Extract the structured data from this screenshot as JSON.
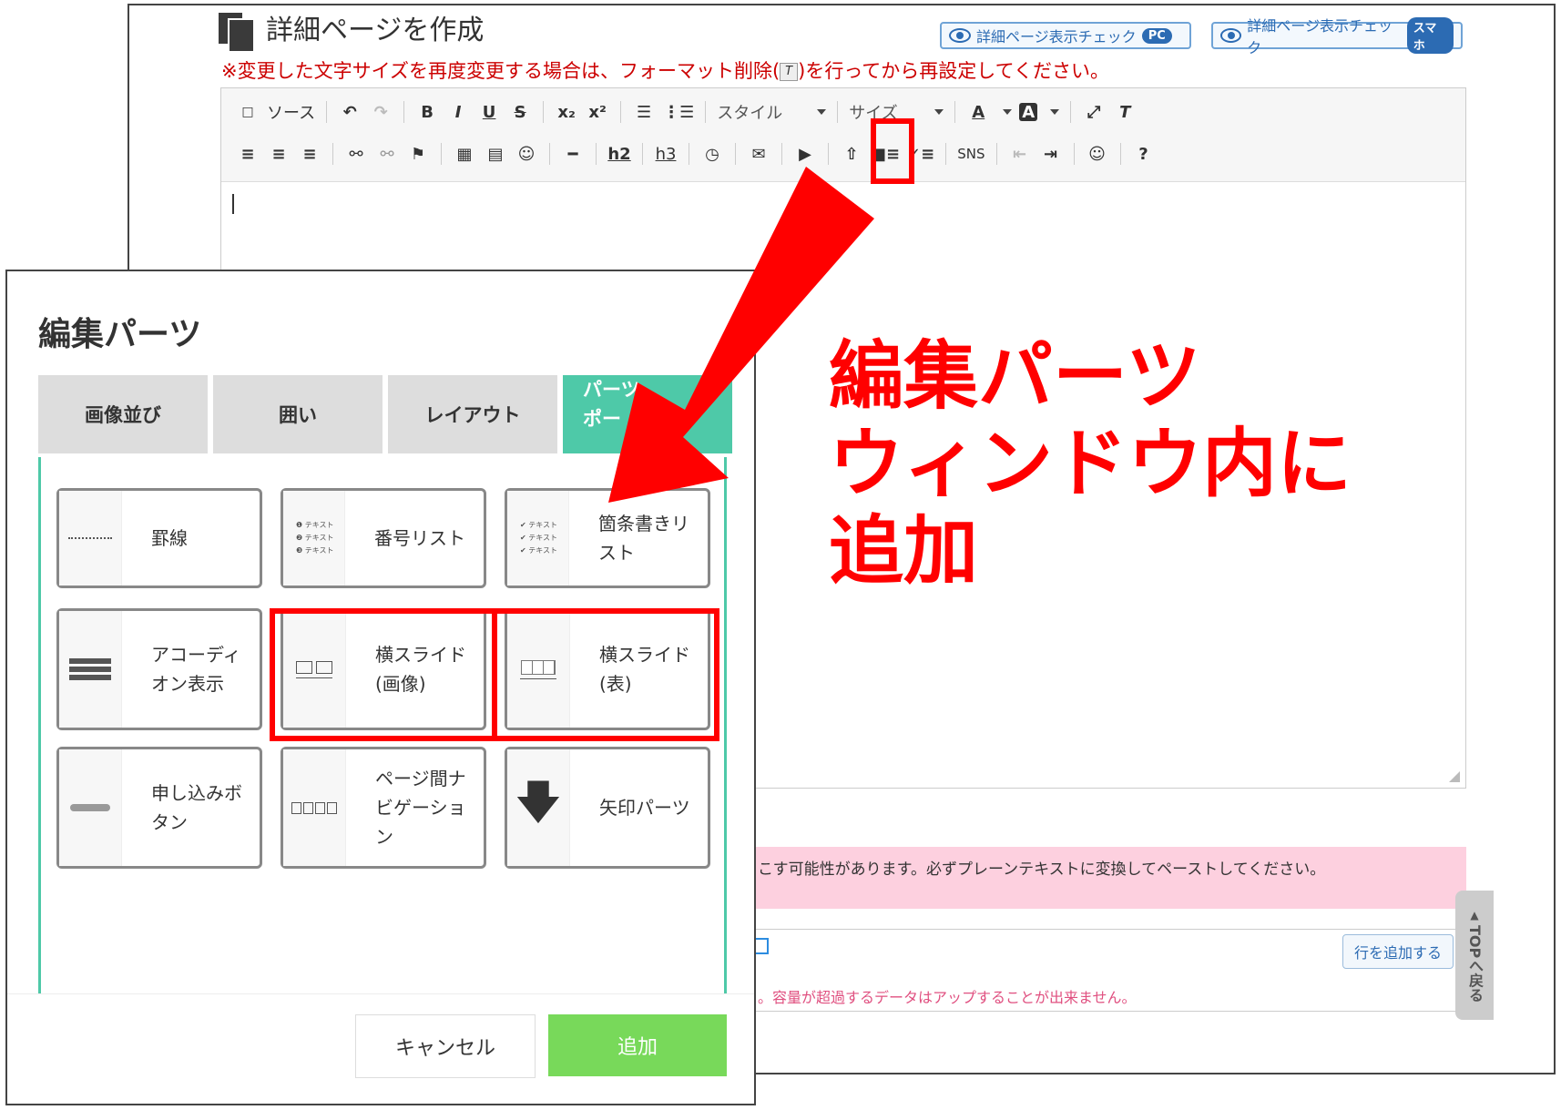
{
  "page": {
    "title": "詳細ページを作成",
    "check_pc": {
      "label": "詳細ページ表示チェック",
      "tag": "PC"
    },
    "check_sp": {
      "label": "詳細ページ表示チェック",
      "tag": "スマホ"
    },
    "notice_before": "※変更した文字サイズを再度変更する場合は、フォーマット削除(",
    "notice_icon": "T",
    "notice_after": ")を行ってから再設定してください。"
  },
  "toolbar": {
    "source": "ソース",
    "style_label": "スタイル",
    "size_label": "サイズ",
    "bold": "B",
    "italic": "I",
    "underline": "U",
    "strike": "S",
    "subscript": "x₂",
    "superscript": "x²",
    "h2": "h2",
    "h3": "h3",
    "sns": "SNS",
    "help": "?"
  },
  "bottom": {
    "paste_warning": "こす可能性があります。必ずプレーンテキストに変換してペーストしてください。",
    "add_row": "行を追加する",
    "capacity_warning": "。容量が超過するデータはアップすることが出来ません。",
    "top_button": "TOPへ戻る"
  },
  "modal": {
    "title": "編集パーツ",
    "tabs": [
      {
        "label": "画像並び"
      },
      {
        "label": "囲い"
      },
      {
        "label": "レイアウト"
      },
      {
        "label": "パーツ",
        "label2": "ポー"
      }
    ],
    "parts": [
      {
        "label": "罫線",
        "icon": "dotted-line-icon"
      },
      {
        "label": "番号リスト",
        "icon": "numbered-list-icon"
      },
      {
        "label": "箇条書きリスト",
        "icon": "bullet-list-icon"
      },
      {
        "label": "アコーディオン表示",
        "icon": "accordion-icon"
      },
      {
        "label": "横スライド(画像)",
        "icon": "image-slide-icon"
      },
      {
        "label": "横スライド(表)",
        "icon": "table-slide-icon"
      },
      {
        "label": "申し込みボタン",
        "icon": "apply-button-icon"
      },
      {
        "label": "ページ間ナビゲーション",
        "icon": "page-nav-icon"
      },
      {
        "label": "矢印パーツ",
        "icon": "down-arrow-icon"
      }
    ],
    "thumb_text": "テキスト",
    "cancel": "キャンセル",
    "add": "追加"
  },
  "annotation": {
    "lines": [
      "編集パーツ",
      "ウィンドウ内に",
      "追加"
    ],
    "color": "#ff0000"
  }
}
